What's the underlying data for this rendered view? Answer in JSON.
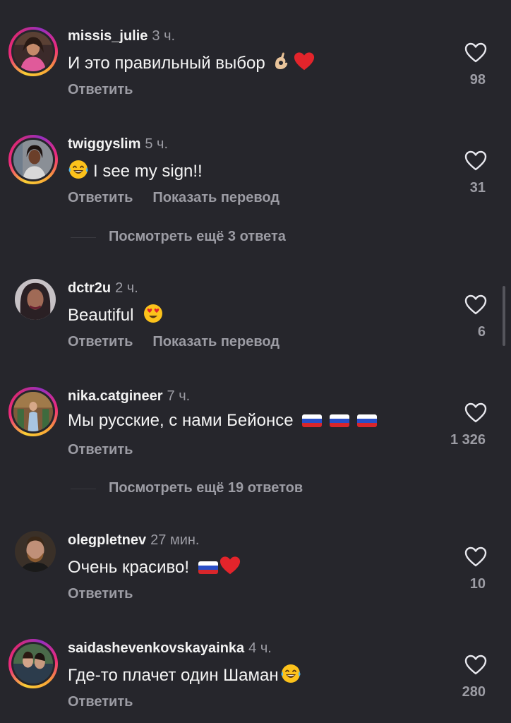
{
  "comments": [
    {
      "username": "missis_julie",
      "time": "3 ч.",
      "text": "И это правильный выбор",
      "reply": "Ответить",
      "likes": "98"
    },
    {
      "username": "twiggyslim",
      "time": "5 ч.",
      "text": "I see my sign!!",
      "reply": "Ответить",
      "translate": "Показать перевод",
      "likes": "31"
    },
    {
      "username": "dctr2u",
      "time": "2 ч.",
      "text": "Beautiful",
      "reply": "Ответить",
      "translate": "Показать перевод",
      "likes": "6"
    },
    {
      "username": "nika.catgineer",
      "time": "7 ч.",
      "text": "Мы русские, с нами Бейонсе",
      "reply": "Ответить",
      "likes": "1 326"
    },
    {
      "username": "olegpletnev",
      "time": "27 мин.",
      "text": "Очень красиво!",
      "reply": "Ответить",
      "likes": "10"
    },
    {
      "username": "saidashevenkovskayainka",
      "time": "4 ч.",
      "text": "Где-то плачет один Шаман",
      "reply": "Ответить",
      "likes": "280"
    }
  ],
  "more_replies": [
    {
      "label": "Посмотреть ещё 3 ответа"
    },
    {
      "label": "Посмотреть ещё 19 ответов"
    }
  ],
  "icons": {
    "like": "heart-outline-icon",
    "emoji_ok": "ok-hand-emoji",
    "emoji_heart": "red-heart-emoji",
    "emoji_laugh": "tears-of-joy-emoji",
    "emoji_hearteyes": "heart-eyes-emoji",
    "flag": "russia-flag-emoji"
  },
  "colors": {
    "background": "#26262c",
    "muted": "#9c9ca4",
    "ring_start": "#f9ce34",
    "ring_mid": "#ee2a7b",
    "ring_end": "#962fbf"
  }
}
